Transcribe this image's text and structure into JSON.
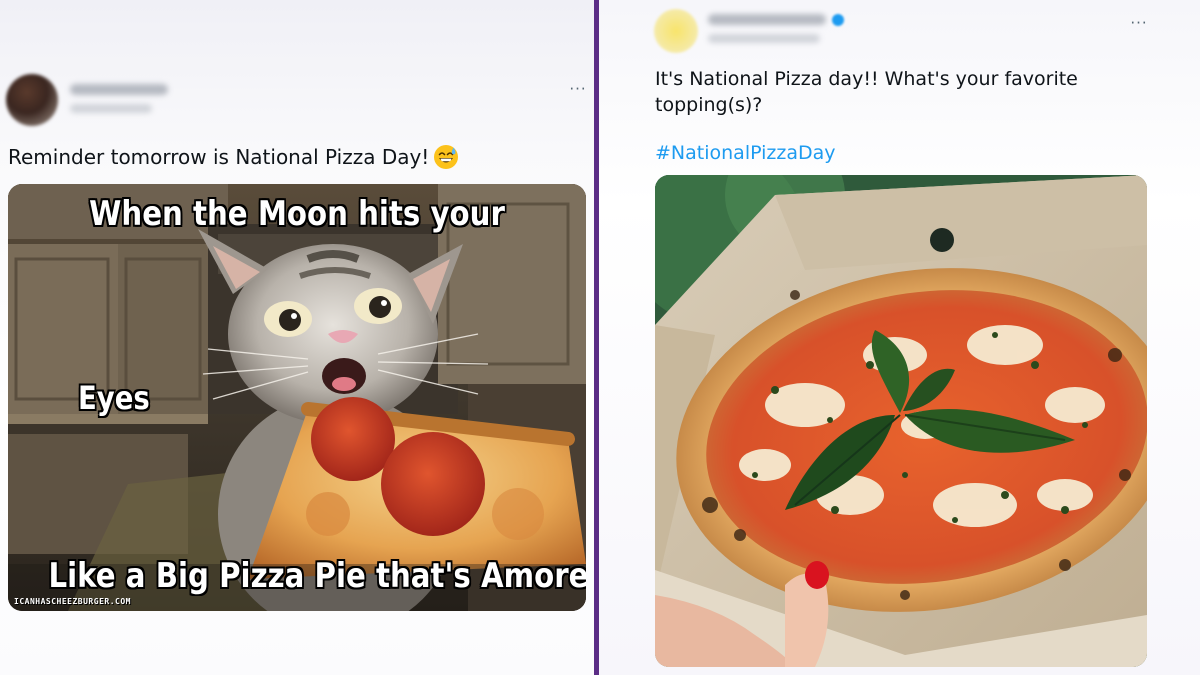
{
  "left_tweet": {
    "text": "Reminder tomorrow is National Pizza Day!",
    "emoji": "grinning-face-with-sweat",
    "more_label": "···",
    "meme": {
      "caption_top": "When the Moon hits your",
      "caption_middle": "Eyes",
      "caption_bottom": "Like a Big Pizza Pie that's Amore",
      "watermark": "ICANHASCHEEZBURGER.COM"
    }
  },
  "right_tweet": {
    "text": "It's National Pizza day!! What's your favorite topping(s)?",
    "hashtag": "#NationalPizzaDay",
    "more_label": "···"
  },
  "colors": {
    "divider": "#5b2d86",
    "hashtag": "#1d9bf0",
    "text": "#0f1419",
    "muted": "#536471"
  }
}
